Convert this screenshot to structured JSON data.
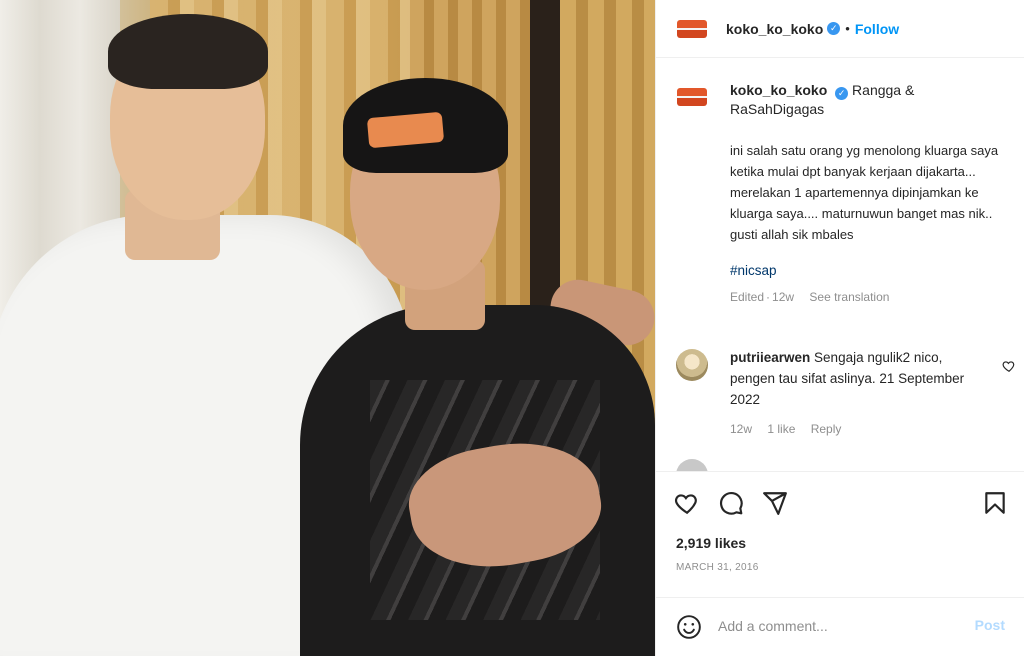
{
  "header": {
    "username": "koko_ko_koko",
    "dot": "•",
    "follow_label": "Follow",
    "verified_icon": "verified-badge-icon"
  },
  "caption": {
    "username": "koko_ko_koko",
    "tags": "Rangga & RaSahDigagas",
    "text": "ini salah satu orang yg menolong kluarga saya ketika mulai dpt banyak kerjaan dijakarta... merelakan 1 apartemennya dipinjamkan ke kluarga saya.... maturnuwun banget mas nik.. gusti allah sik mbales",
    "hashtag": "#nicsap",
    "edited": "Edited",
    "time": "12w",
    "see_translation": "See translation"
  },
  "comment": {
    "username": "putriiearwen",
    "text": "Sengaja ngulik2 nico, pengen tau sifat aslinya. 21 September 2022",
    "time": "12w",
    "likes": "1 like",
    "reply": "Reply"
  },
  "actions": {
    "likes_count": "2,919 likes",
    "date": "MARCH 31, 2016"
  },
  "comment_bar": {
    "placeholder": "Add a comment...",
    "post_label": "Post"
  },
  "colors": {
    "follow_blue": "#0095f6",
    "post_disabled": "#b3dbff",
    "verified_blue": "#3897f0"
  }
}
